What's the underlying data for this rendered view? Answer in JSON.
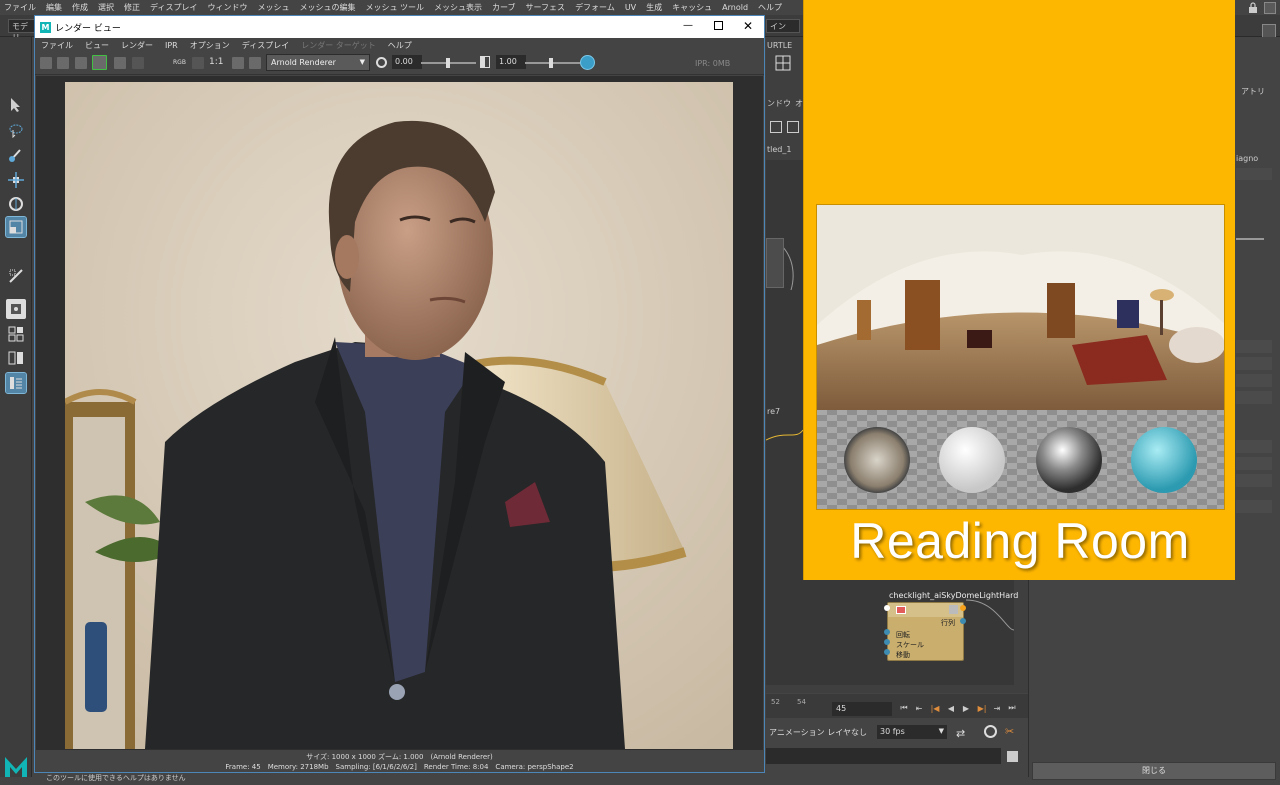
{
  "maya_menu": [
    "ファイル",
    "編集",
    "作成",
    "選択",
    "修正",
    "ディスプレイ",
    "ウィンドウ",
    "メッシュ",
    "メッシュの編集",
    "メッシュ ツール",
    "メッシュ表示",
    "カーブ",
    "サーフェス",
    "デフォーム",
    "UV",
    "生成",
    "キャッシュ",
    "Arnold",
    "ヘルプ"
  ],
  "status_left_dropdown": "モデリ",
  "status_right_dropdown": "イン",
  "render_view": {
    "title": "レンダー ビュー",
    "menu": [
      "ファイル",
      "ビュー",
      "レンダー",
      "IPR",
      "オプション",
      "ディスプレイ",
      "レンダー ターゲット",
      "ヘルプ"
    ],
    "renderer": "Arnold Renderer",
    "exposure": "0.00",
    "gamma": "1.00",
    "ratio_label": "1:1",
    "rgb_label": "RGB",
    "ipr_mem": "IPR: 0MB",
    "info_line1": "サイズ: 1000 x 1000 ズーム: 1.000　(Arnold Renderer)",
    "info_line2": "Frame: 45　Memory: 2718Mb　Sampling: [6/1/6/2/6/2]　Render Time: 8:04　Camera: perspShape2"
  },
  "side_labels": {
    "turtle": "URTLE",
    "window_tab": "ンドウ",
    "window_tab2": "オ",
    "untitled": "tled_1",
    "attr": "アトリ",
    "diag": "iagno",
    "re7": "re7"
  },
  "hdri_card": {
    "title": "Reading Room"
  },
  "node": {
    "name": "checklight_aiSkyDomeLightHard",
    "output": "行列",
    "inputs": [
      "回転",
      "スケール",
      "移動"
    ]
  },
  "timeline": {
    "ticks": [
      "52",
      "54"
    ],
    "current_frame": "45",
    "anim_layer": "アニメーション レイヤなし",
    "fps": "30 fps"
  },
  "close_button": "閉じる",
  "help_line": "このツールに使用できるヘルプはありません",
  "colors": {
    "accent_blue": "#4c86b8",
    "card_orange": "#feb700",
    "node_gold": "#c9ae6e",
    "maya_bg": "#444444"
  }
}
